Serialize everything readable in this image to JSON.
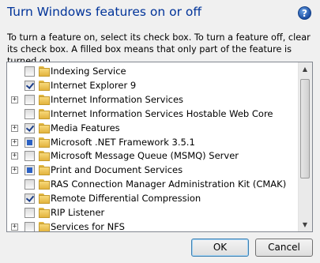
{
  "dialog": {
    "title": "Turn Windows features on or off",
    "help_icon": "?",
    "description": "To turn a feature on, select its check box. To turn a feature off, clear its check box. A filled box means that only part of the feature is turned on."
  },
  "features": [
    {
      "label": "Indexing Service",
      "state": "unchecked",
      "expandable": false
    },
    {
      "label": "Internet Explorer 9",
      "state": "checked",
      "expandable": false
    },
    {
      "label": "Internet Information Services",
      "state": "unchecked",
      "expandable": true
    },
    {
      "label": "Internet Information Services Hostable Web Core",
      "state": "unchecked",
      "expandable": false
    },
    {
      "label": "Media Features",
      "state": "checked",
      "expandable": true
    },
    {
      "label": "Microsoft .NET Framework 3.5.1",
      "state": "partial",
      "expandable": true
    },
    {
      "label": "Microsoft Message Queue (MSMQ) Server",
      "state": "unchecked",
      "expandable": true
    },
    {
      "label": "Print and Document Services",
      "state": "partial",
      "expandable": true
    },
    {
      "label": "RAS Connection Manager Administration Kit (CMAK)",
      "state": "unchecked",
      "expandable": false
    },
    {
      "label": "Remote Differential Compression",
      "state": "checked",
      "expandable": false
    },
    {
      "label": "RIP Listener",
      "state": "unchecked",
      "expandable": false
    },
    {
      "label": "Services for NFS",
      "state": "unchecked",
      "expandable": true
    }
  ],
  "expander_symbol": "+",
  "scrollbar": {
    "up_arrow": "▲",
    "down_arrow": "▼"
  },
  "buttons": {
    "ok": "OK",
    "cancel": "Cancel"
  }
}
